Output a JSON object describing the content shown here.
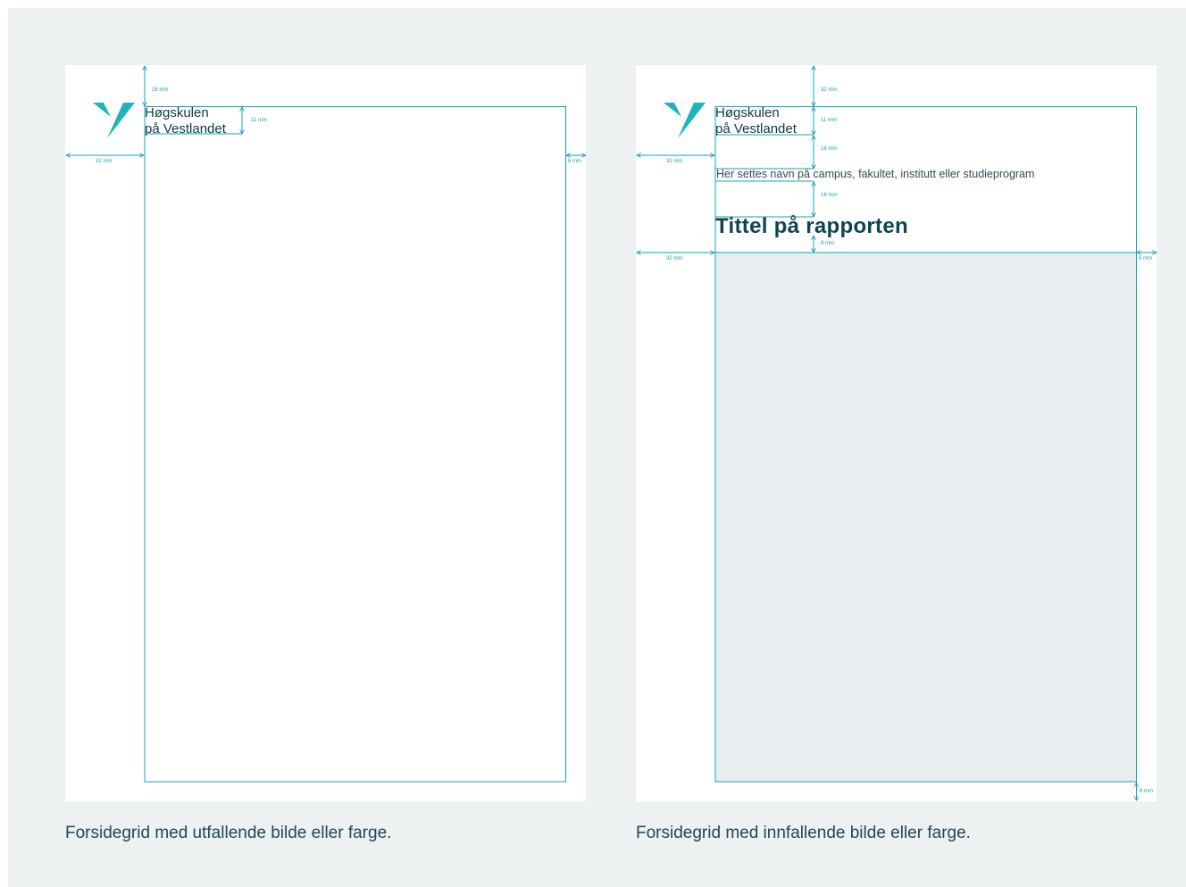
{
  "brand": {
    "line1": "Høgskulen",
    "line2": "på Vestlandet",
    "logo_color": "#1fb3be",
    "text_color": "#0e3a46"
  },
  "colors": {
    "background": "#eef1f2",
    "page": "#ffffff",
    "guide": "#1aa0b2",
    "image_area": "#e8eef0"
  },
  "left_page": {
    "dimensions": {
      "top": "16 mm",
      "logo": "11 mm",
      "left": "32 mm",
      "right": "8 mm"
    },
    "caption": "Forsidegrid med utfallende bilde eller farge."
  },
  "right_page": {
    "campus_line": "Her settes navn på campus, fakultet, institutt eller studieprogram",
    "title": "Tittel på rapporten",
    "dimensions": {
      "top": "32 mm",
      "logo": "11 mm",
      "gap1": "16 mm",
      "gap2": "16 mm",
      "title_gap": "8 mm",
      "left_top": "32 mm",
      "left_image": "32 mm",
      "right": "8 mm",
      "bottom": "8 mm"
    },
    "caption": "Forsidegrid med innfallende bilde eller farge."
  }
}
